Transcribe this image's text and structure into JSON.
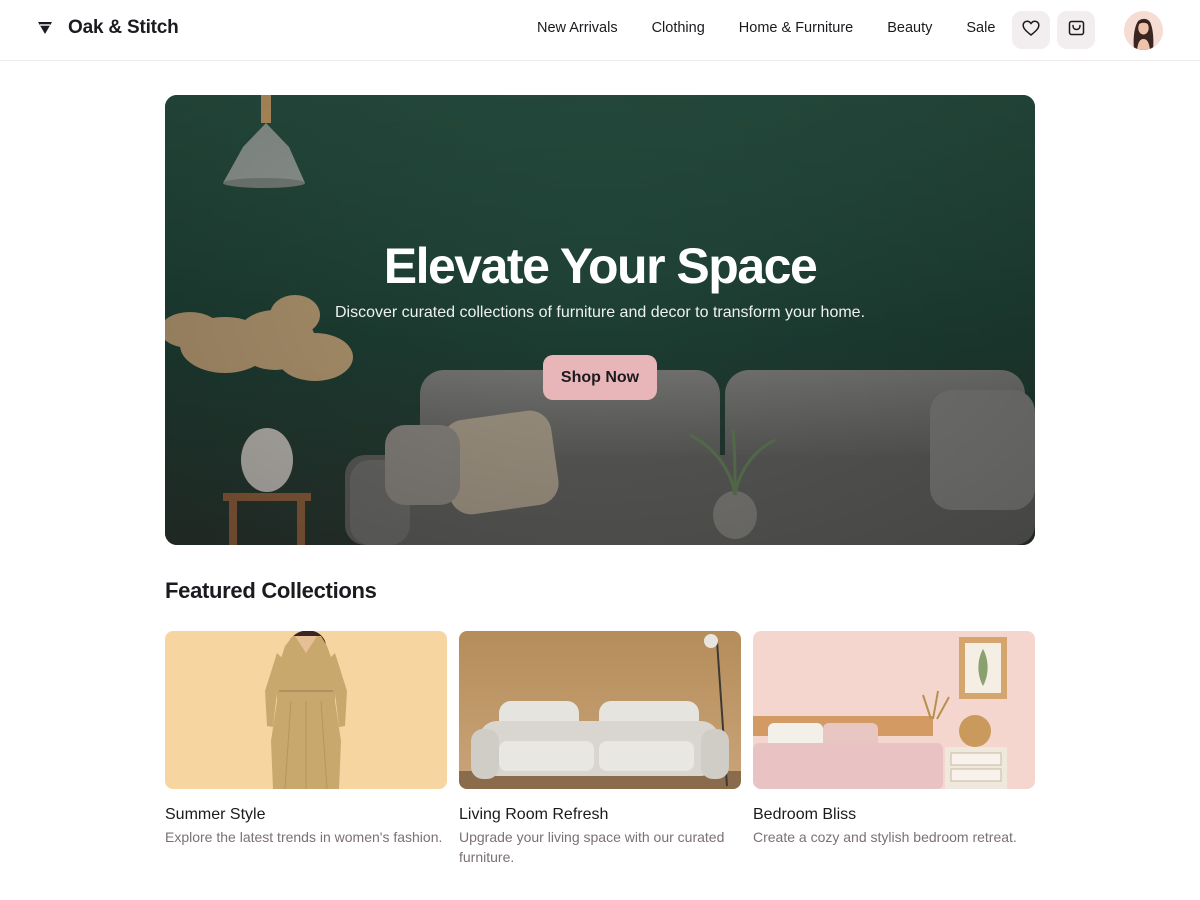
{
  "brand": {
    "name": "Oak & Stitch",
    "icon": "diamond-logo-icon"
  },
  "nav": {
    "items": [
      "New Arrivals",
      "Clothing",
      "Home & Furniture",
      "Beauty",
      "Sale"
    ]
  },
  "header_actions": {
    "favorites_icon": "heart-icon",
    "cart_icon": "shopping-bag-icon",
    "avatar": "user-avatar"
  },
  "hero": {
    "title": "Elevate Your Space",
    "subtitle": "Discover curated collections of furniture and decor to transform your home.",
    "cta_label": "Shop Now"
  },
  "featured": {
    "title": "Featured Collections",
    "collections": [
      {
        "title": "Summer Style",
        "description": "Explore the latest trends in women's fashion."
      },
      {
        "title": "Living Room Refresh",
        "description": "Upgrade your living space with our curated furniture."
      },
      {
        "title": "Bedroom Bliss",
        "description": "Create a cozy and stylish bedroom retreat."
      }
    ]
  },
  "colors": {
    "accent": "#e8b6b9",
    "hero_green": "#24483d",
    "text": "#1b1a1f",
    "muted": "#7b7175"
  }
}
